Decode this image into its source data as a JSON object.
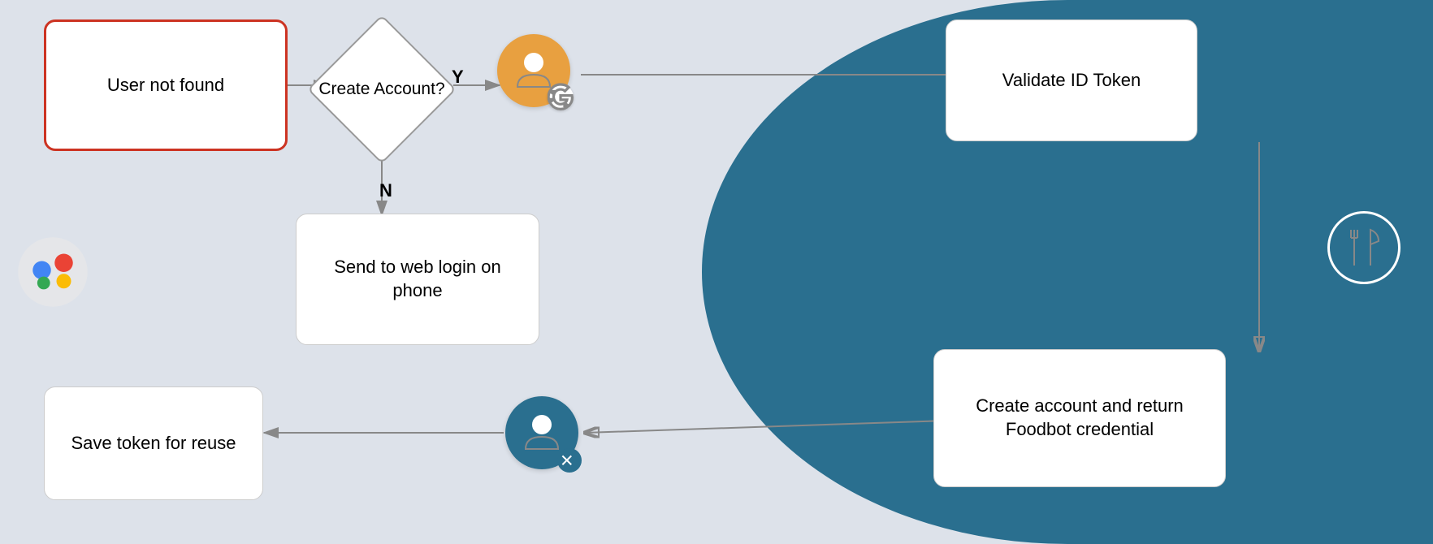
{
  "background": {
    "left_color": "#dde2ea",
    "right_color": "#2a6f8f"
  },
  "boxes": {
    "user_not_found": "User not found",
    "create_account": "Create Account?",
    "send_to_web": "Send to web login on phone",
    "save_token": "Save token for reuse",
    "validate_id": "Validate ID Token",
    "create_account_return": "Create account and return Foodbot credential"
  },
  "labels": {
    "yes": "Y",
    "no": "N"
  },
  "icons": {
    "google_assistant": "google-assistant-icon",
    "google_user": "google-user-icon",
    "foodbot_user": "foodbot-user-icon",
    "fork_knife": "fork-knife-icon"
  }
}
